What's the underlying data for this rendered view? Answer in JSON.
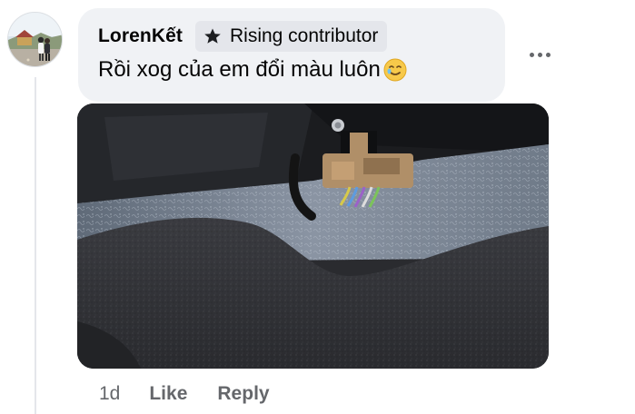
{
  "comment": {
    "author": "LorenKết",
    "badge_label": "Rising contributor",
    "badge_icon": "star-icon",
    "text": "Rồi xog của em đổi màu luôn",
    "emoji": "smiling-face-with-tear-emoji",
    "more_icon": "more-options-icon",
    "photo_alt": "photo"
  },
  "actions": {
    "time": "1d",
    "like_label": "Like",
    "reply_label": "Reply"
  },
  "colors": {
    "bubble_bg": "#f0f2f5",
    "badge_bg": "#e4e6eb",
    "primary_text": "#050505",
    "secondary_text": "#65676b"
  }
}
